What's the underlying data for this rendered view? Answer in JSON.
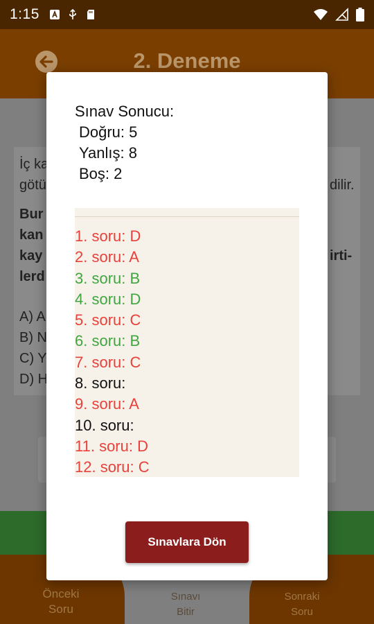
{
  "status_bar": {
    "time": "1:15",
    "icons_left": [
      "text-a-icon",
      "usb-icon",
      "sd-card-icon"
    ],
    "icons_right": [
      "wifi-icon",
      "signal-icon",
      "battery-icon"
    ]
  },
  "app_bar": {
    "title": "2. Deneme",
    "back_icon": "back-arrow-icon"
  },
  "question": {
    "line1": "İç ka",
    "line1_end": "dilir.",
    "line2": "götü",
    "bold_line1": "Bur",
    "bold_line2": "kan",
    "bold_line3": "kay",
    "bold_line3_end": "irti-",
    "bold_line4": "lerd",
    "options": [
      "A) A",
      "B) N",
      "C) Y",
      "D) H"
    ]
  },
  "bottom_nav": {
    "prev": [
      "Önceki",
      "Soru"
    ],
    "finish": [
      "Sınavı",
      "Bitir"
    ],
    "next": [
      "Sonraki",
      "Soru"
    ]
  },
  "dialog": {
    "title": "Sınav Sonucu:",
    "correct": "Doğru: 5",
    "wrong": "Yanlış: 8",
    "empty": "Boş: 2",
    "results": [
      {
        "text": "1. soru: D",
        "status": "wrong"
      },
      {
        "text": "2. soru: A",
        "status": "wrong"
      },
      {
        "text": "3. soru: B",
        "status": "correct"
      },
      {
        "text": "4. soru: D",
        "status": "correct"
      },
      {
        "text": "5. soru: C",
        "status": "wrong"
      },
      {
        "text": "6. soru: B",
        "status": "correct"
      },
      {
        "text": "7. soru: C",
        "status": "wrong"
      },
      {
        "text": "8. soru:",
        "status": "empty"
      },
      {
        "text": "9. soru: A",
        "status": "wrong"
      },
      {
        "text": "10. soru:",
        "status": "empty"
      },
      {
        "text": "11. soru: D",
        "status": "wrong"
      },
      {
        "text": "12. soru: C",
        "status": "wrong"
      }
    ],
    "button_label": "Sınavlara Dön"
  },
  "colors": {
    "correct": "#3fa63f",
    "wrong": "#e8403a",
    "empty": "#111111",
    "button": "#8b1d1d",
    "status_bar": "#4a2600",
    "app_bar": "#7a3e00"
  }
}
